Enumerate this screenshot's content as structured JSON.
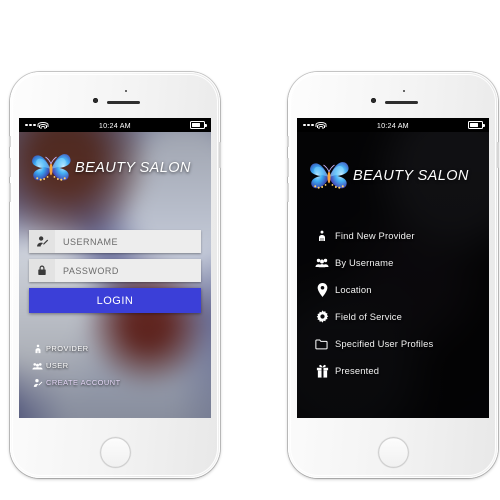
{
  "statusbar": {
    "time": "10:24 AM",
    "signal_icon": "signal-dots-icon",
    "wifi_icon": "wifi-icon",
    "battery_icon": "battery-icon"
  },
  "brand": {
    "name": "BEAUTY SALON",
    "logo_icon": "butterfly-logo-icon"
  },
  "colors": {
    "login_button": "#3b3fd8",
    "field_bg": "#ededed",
    "placeholder_text": "#6a6a6a",
    "accent_link": "#e3d5f5"
  },
  "login_screen": {
    "username_field": {
      "placeholder": "USERNAME",
      "value": "",
      "icon": "user-edit-icon"
    },
    "password_field": {
      "placeholder": "PASSWORD",
      "value": "",
      "icon": "lock-icon"
    },
    "login_button_label": "LOGIN",
    "links": [
      {
        "label": "PROVIDER",
        "icon": "provider-person-icon"
      },
      {
        "label": "USER",
        "icon": "users-group-icon"
      },
      {
        "label": "CREATE ACCOUNT",
        "icon": "user-edit-icon"
      }
    ]
  },
  "menu_screen": {
    "items": [
      {
        "label": "Find New Provider",
        "icon": "provider-person-icon"
      },
      {
        "label": "By Username",
        "icon": "users-group-icon"
      },
      {
        "label": "Location",
        "icon": "location-pin-icon"
      },
      {
        "label": "Field of Service",
        "icon": "gear-icon"
      },
      {
        "label": "Specified User Profiles",
        "icon": "folder-icon"
      },
      {
        "label": "Presented",
        "icon": "gift-icon"
      }
    ]
  }
}
